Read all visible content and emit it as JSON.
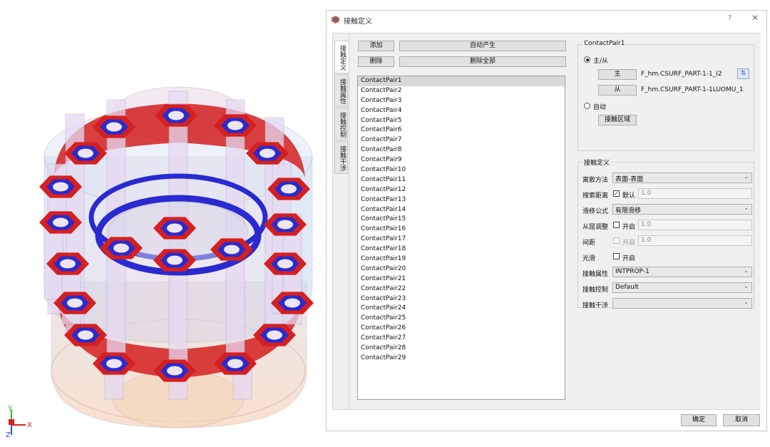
{
  "dialog": {
    "title": "接触定义",
    "help_label": "?",
    "close_label": "✕"
  },
  "tabs": [
    {
      "label": "接触定义",
      "active": true
    },
    {
      "label": "接触属性",
      "active": false
    },
    {
      "label": "接触控制",
      "active": false
    },
    {
      "label": "接触干涉",
      "active": false
    }
  ],
  "toolbar": {
    "add_label": "添加",
    "auto_generate_label": "自动产生",
    "delete_label": "删除",
    "delete_all_label": "删除全部"
  },
  "contact_list": {
    "selected": "ContactPair1",
    "items": [
      "ContactPair1",
      "ContactPair2",
      "ContactPair3",
      "ContactPair4",
      "ContactPair5",
      "ContactPair6",
      "ContactPair7",
      "ContactPair8",
      "ContactPair9",
      "ContactPair10",
      "ContactPair11",
      "ContactPair12",
      "ContactPair13",
      "ContactPair14",
      "ContactPair15",
      "ContactPair16",
      "ContactPair17",
      "ContactPair18",
      "ContactPair19",
      "ContactPair20",
      "ContactPair21",
      "ContactPair22",
      "ContactPair23",
      "ContactPair24",
      "ContactPair25",
      "ContactPair26",
      "ContactPair27",
      "ContactPair28",
      "ContactPair29"
    ]
  },
  "pair_group": {
    "title": "ContactPair1",
    "master_slave_label": "主/从",
    "master_button": "主",
    "master_value": "F_hm.CSURF_PART-1-1_I2",
    "slave_button": "从",
    "slave_value": "F_hm.CSURF_PART-1-1LUOMU_1",
    "auto_label": "自动",
    "contact_region_button": "接触区域",
    "mode": "master-slave"
  },
  "definition_group": {
    "title": "接触定义",
    "discretization_label": "离散方法",
    "discretization_value": "表面-表面",
    "search_distance_label": "搜索距离",
    "search_default_label": "默认",
    "search_default_checked": true,
    "search_distance_value": "1.0",
    "sliding_label": "滑移公式",
    "sliding_value": "有限滑移",
    "slave_adjust_label": "从屈调整",
    "slave_adjust_enable_label": "开启",
    "slave_adjust_value": "1.0",
    "clearance_label": "间距",
    "clearance_enable_label": "开启",
    "clearance_value": "1.0",
    "smooth_label": "光滑",
    "smooth_enable_label": "开启",
    "property_label": "接触属性",
    "property_value": "INTPROP-1",
    "control_label": "接触控制",
    "control_value": "Default",
    "interference_label": "接触干涉",
    "interference_value": ""
  },
  "footer": {
    "ok_label": "确定",
    "cancel_label": "取消"
  },
  "axis_triad": {
    "x_label": "X",
    "y_label": "Y",
    "z_label": "Z"
  },
  "colors": {
    "master_red": "#d42020",
    "slave_blue": "#2a2ad0",
    "accent": "#2a5bd7"
  }
}
